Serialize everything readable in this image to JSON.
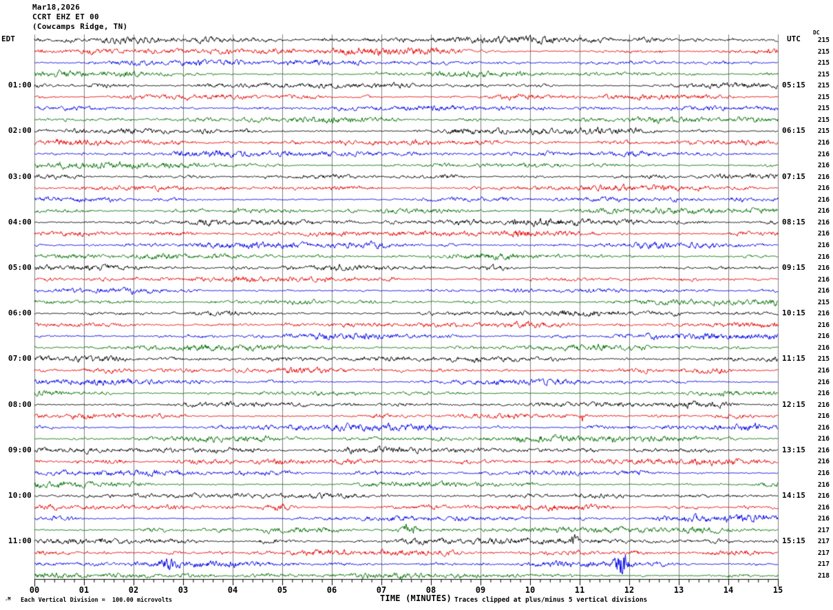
{
  "header": {
    "date": "Mar18,2026",
    "channel": "CCRT EHZ ET 00",
    "location": "(Cowcamps Ridge, TN)"
  },
  "axis": {
    "left_timezone": "EDT",
    "right_timezone": "UTC",
    "dc_column_header": "DC",
    "x_title": "TIME (MINUTES)",
    "x_tick_labels": [
      "00",
      "01",
      "02",
      "03",
      "04",
      "05",
      "06",
      "07",
      "08",
      "09",
      "10",
      "11",
      "12",
      "13",
      "14",
      "15"
    ]
  },
  "footer": {
    "corner_mark": ".M",
    "scale_note": "Each Vertical Division =  100.00 microvolts",
    "clip_note": "Traces clipped at plus/minus 5 vertical divisions"
  },
  "chart_data": {
    "type": "line",
    "variant": "seismic-helicorder",
    "title": "CCRT EHZ ET 00 (Cowcamps Ridge, TN) Mar18,2026",
    "xlabel": "TIME (MINUTES)",
    "x_range_minutes": [
      0,
      15
    ],
    "x_major_tick_min": 1,
    "x_minor_tick_min": 0.2,
    "num_traces": 48,
    "minutes_per_trace": 15,
    "trace_color_cycle": [
      "#000000",
      "#e60000",
      "#0000e6",
      "#007000"
    ],
    "grid_color": "#7d7d7d",
    "microvolts_per_division": 100,
    "clip_divisions": 5,
    "row_time_labels": [
      {
        "trace_index": 4,
        "edt": "01:00",
        "utc": "05:15"
      },
      {
        "trace_index": 8,
        "edt": "02:00",
        "utc": "06:15"
      },
      {
        "trace_index": 12,
        "edt": "03:00",
        "utc": "07:15"
      },
      {
        "trace_index": 16,
        "edt": "04:00",
        "utc": "08:15"
      },
      {
        "trace_index": 20,
        "edt": "05:00",
        "utc": "09:15"
      },
      {
        "trace_index": 24,
        "edt": "06:00",
        "utc": "10:15"
      },
      {
        "trace_index": 28,
        "edt": "07:00",
        "utc": "11:15"
      },
      {
        "trace_index": 32,
        "edt": "08:00",
        "utc": "12:15"
      },
      {
        "trace_index": 36,
        "edt": "09:00",
        "utc": "13:15"
      },
      {
        "trace_index": 40,
        "edt": "10:00",
        "utc": "14:15"
      },
      {
        "trace_index": 44,
        "edt": "11:00",
        "utc": "15:15"
      }
    ],
    "dc_offsets": [
      215,
      215,
      215,
      215,
      215,
      215,
      215,
      215,
      215,
      216,
      216,
      216,
      216,
      216,
      216,
      216,
      216,
      216,
      216,
      216,
      216,
      216,
      216,
      215,
      216,
      216,
      216,
      216,
      215,
      216,
      216,
      216,
      216,
      216,
      216,
      216,
      216,
      216,
      216,
      216,
      216,
      216,
      216,
      217,
      217,
      217,
      217,
      218
    ],
    "events": [
      {
        "trace_index": 46,
        "minute": 11.85,
        "rel_amplitude": 2.6,
        "sigma_min": 0.09,
        "note": "strong burst, blue trace"
      },
      {
        "trace_index": 46,
        "minute": 2.72,
        "rel_amplitude": 1.0,
        "sigma_min": 0.1,
        "note": "moderate burst, blue trace"
      },
      {
        "trace_index": 43,
        "minute": 7.55,
        "rel_amplitude": 0.9,
        "sigma_min": 0.12,
        "note": "small burst, green trace"
      },
      {
        "trace_index": 44,
        "minute": 10.9,
        "rel_amplitude": 0.9,
        "sigma_min": 0.05,
        "note": "small burst, black trace"
      },
      {
        "trace_index": 41,
        "minute": 4.9,
        "rel_amplitude": 0.6,
        "sigma_min": 0.25,
        "note": "elevated noise, red trace"
      },
      {
        "trace_index": 33,
        "minute": 11.05,
        "rel_amplitude": 0.8,
        "sigma_min": 0.04,
        "note": "spike, red trace"
      }
    ]
  }
}
